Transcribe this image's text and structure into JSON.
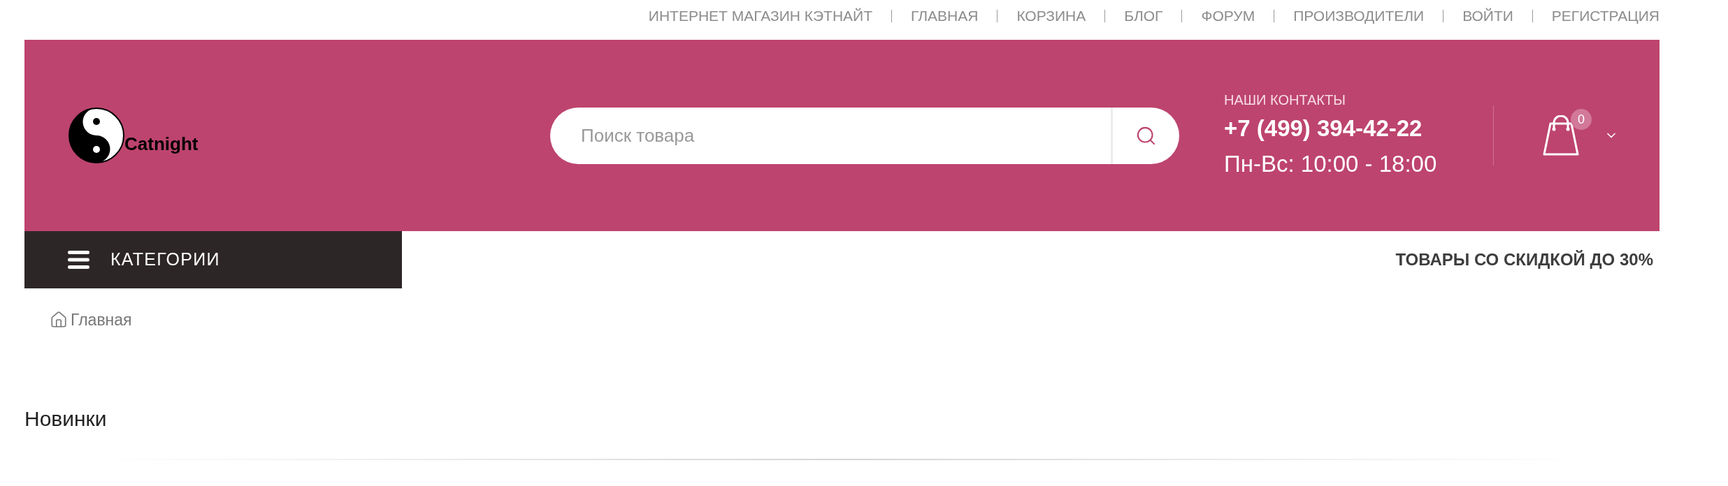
{
  "top_nav": {
    "links": [
      "ИНТЕРНЕТ МАГАЗИН КЭТНАЙТ",
      "ГЛАВНАЯ",
      "КОРЗИНА",
      "БЛОГ",
      "ФОРУМ",
      "ПРОИЗВОДИТЕЛИ",
      "ВОЙТИ",
      "РЕГИСТРАЦИЯ"
    ]
  },
  "header": {
    "logo": {
      "text": "Catnight"
    },
    "search": {
      "placeholder": "Поиск товара"
    },
    "contacts": {
      "label": "НАШИ КОНТАКТЫ",
      "phone": "+7 (499) 394-42-22",
      "hours": "Пн-Вс: 10:00 - 18:00"
    },
    "cart": {
      "count": "0"
    }
  },
  "nav_bar": {
    "categories_button": "КАТЕГОРИИ",
    "promo": "ТОВАРЫ СО СКИДКОЙ ДО 30%"
  },
  "breadcrumb": [
    {
      "label": "Главная"
    }
  ],
  "section": {
    "title": "Новинки"
  }
}
